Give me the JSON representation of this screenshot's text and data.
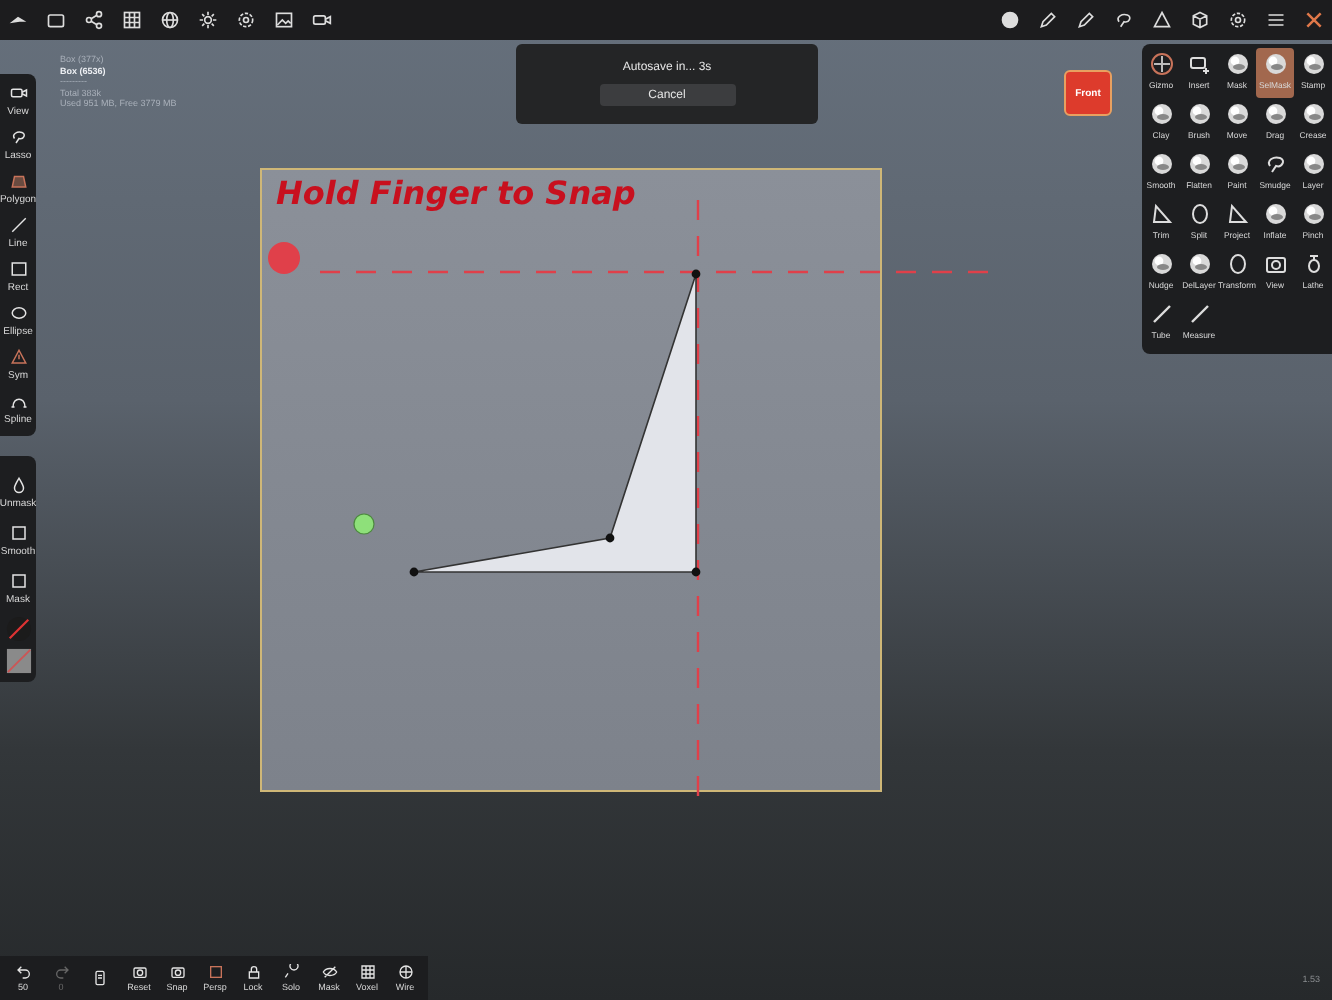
{
  "scene_info": [
    {
      "text": "Box (377x)",
      "selected": false
    },
    {
      "text": "Box (6536)",
      "selected": true
    },
    {
      "text": "---------",
      "selected": false
    },
    {
      "text": "Total 383k",
      "selected": false
    },
    {
      "text": "Used 951 MB,  Free 3779 MB",
      "selected": false
    }
  ],
  "autosave": {
    "message": "Autosave in... 3s",
    "button": "Cancel"
  },
  "view_button": "Front",
  "left_tools": [
    {
      "label": "View",
      "active": false
    },
    {
      "label": "Lasso",
      "active": false
    },
    {
      "label": "Polygon",
      "active": true
    },
    {
      "label": "Line",
      "active": false
    },
    {
      "label": "Rect",
      "active": false
    },
    {
      "label": "Ellipse",
      "active": false
    },
    {
      "label": "Sym",
      "active": true
    },
    {
      "label": "Spline",
      "active": false
    }
  ],
  "mask_tools": [
    {
      "label": "Unmask"
    },
    {
      "label": "Smooth"
    },
    {
      "label": "Mask"
    }
  ],
  "canvas": {
    "hint": "Hold Finger to Snap"
  },
  "brush_panel": [
    {
      "label": "Gizmo",
      "selected": false
    },
    {
      "label": "Insert",
      "selected": false
    },
    {
      "label": "Mask",
      "selected": false
    },
    {
      "label": "SelMask",
      "selected": true
    },
    {
      "label": "Stamp",
      "selected": false
    },
    {
      "label": "Clay",
      "selected": false
    },
    {
      "label": "Brush",
      "selected": false
    },
    {
      "label": "Move",
      "selected": false
    },
    {
      "label": "Drag",
      "selected": false
    },
    {
      "label": "Crease",
      "selected": false
    },
    {
      "label": "Smooth",
      "selected": false
    },
    {
      "label": "Flatten",
      "selected": false
    },
    {
      "label": "Paint",
      "selected": false
    },
    {
      "label": "Smudge",
      "selected": false
    },
    {
      "label": "Layer",
      "selected": false
    },
    {
      "label": "Trim",
      "selected": false
    },
    {
      "label": "Split",
      "selected": false
    },
    {
      "label": "Project",
      "selected": false
    },
    {
      "label": "Inflate",
      "selected": false
    },
    {
      "label": "Pinch",
      "selected": false
    },
    {
      "label": "Nudge",
      "selected": false
    },
    {
      "label": "DelLayer",
      "selected": false
    },
    {
      "label": "Transform",
      "selected": false
    },
    {
      "label": "View",
      "selected": false
    },
    {
      "label": "Lathe",
      "selected": false
    },
    {
      "label": "Tube",
      "selected": false
    },
    {
      "label": "Measure",
      "selected": false
    }
  ],
  "bottom_bar": [
    {
      "label": "50",
      "disabled": false
    },
    {
      "label": "0",
      "disabled": true
    },
    {
      "label": "Reset",
      "disabled": false
    },
    {
      "label": "Snap",
      "disabled": false
    },
    {
      "label": "Persp",
      "disabled": false
    },
    {
      "label": "Lock",
      "disabled": false
    },
    {
      "label": "Solo",
      "disabled": false
    },
    {
      "label": "Mask",
      "disabled": false
    },
    {
      "label": "Voxel",
      "disabled": false
    },
    {
      "label": "Wire",
      "disabled": false
    }
  ],
  "version": "1.53"
}
